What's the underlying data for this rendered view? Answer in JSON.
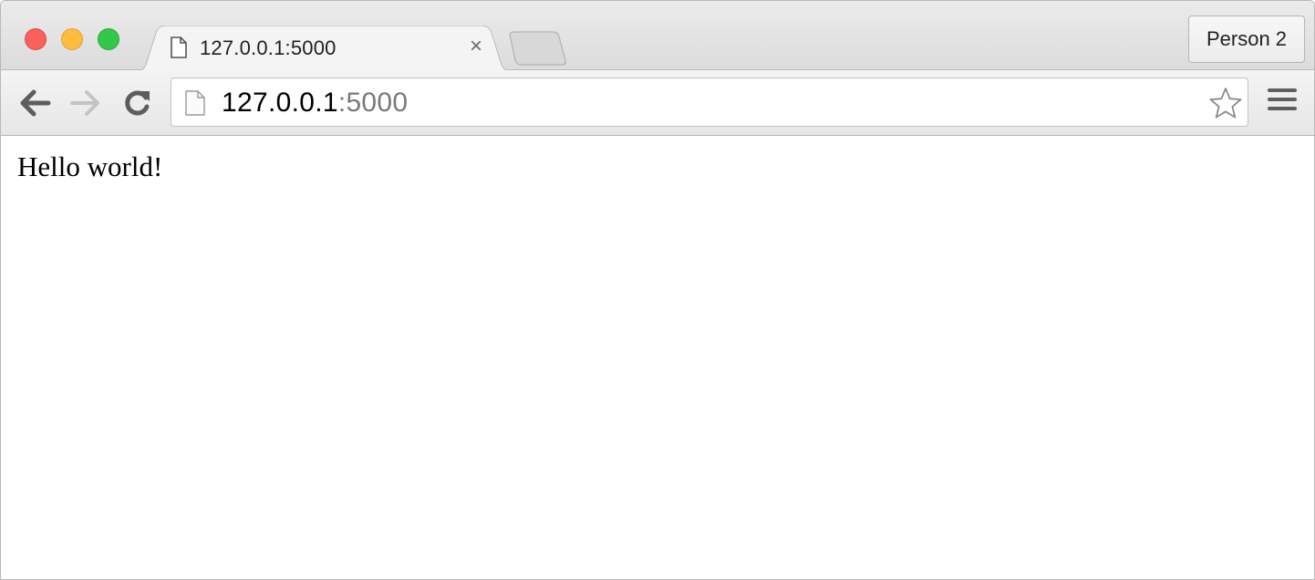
{
  "tab": {
    "title": "127.0.0.1:5000",
    "icon": "page-icon",
    "close_label": "×"
  },
  "profile": {
    "label": "Person 2"
  },
  "address_bar": {
    "host": "127.0.0.1",
    "port": ":5000",
    "icons": [
      "page-icon",
      "star-icon"
    ]
  },
  "toolbar": {
    "icons": [
      "back-arrow-icon",
      "forward-arrow-icon",
      "reload-icon",
      "menu-icon"
    ]
  },
  "page": {
    "body_text": "Hello world!"
  },
  "colors": {
    "close": "#fc605b",
    "minimize": "#fdbc40",
    "maximize": "#34c84a"
  }
}
